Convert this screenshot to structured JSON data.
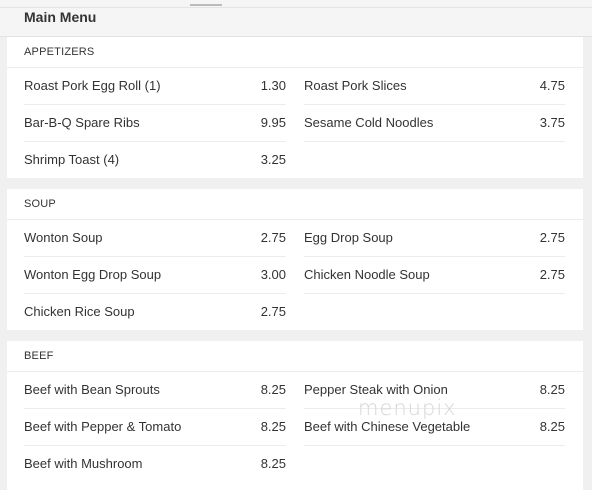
{
  "header": {
    "title": "Main Menu"
  },
  "sections": [
    {
      "name": "APPETIZERS",
      "items": [
        {
          "name": "Roast Pork Egg Roll (1)",
          "price": "1.30"
        },
        {
          "name": "Roast Pork Slices",
          "price": "4.75"
        },
        {
          "name": "Bar-B-Q Spare Ribs",
          "price": "9.95"
        },
        {
          "name": "Sesame Cold Noodles",
          "price": "3.75"
        },
        {
          "name": "Shrimp Toast (4)",
          "price": "3.25"
        }
      ]
    },
    {
      "name": "SOUP",
      "items": [
        {
          "name": "Wonton Soup",
          "price": "2.75"
        },
        {
          "name": "Egg Drop Soup",
          "price": "2.75"
        },
        {
          "name": "Wonton Egg Drop Soup",
          "price": "3.00"
        },
        {
          "name": "Chicken Noodle Soup",
          "price": "2.75"
        },
        {
          "name": "Chicken Rice Soup",
          "price": "2.75"
        }
      ]
    },
    {
      "name": "BEEF",
      "items": [
        {
          "name": "Beef with Bean Sprouts",
          "price": "8.25"
        },
        {
          "name": "Pepper Steak with Onion",
          "price": "8.25"
        },
        {
          "name": "Beef with Pepper & Tomato",
          "price": "8.25"
        },
        {
          "name": "Beef with Chinese Vegetable",
          "price": "8.25"
        },
        {
          "name": "Beef with Mushroom",
          "price": "8.25"
        }
      ]
    }
  ],
  "watermark": "menupix"
}
